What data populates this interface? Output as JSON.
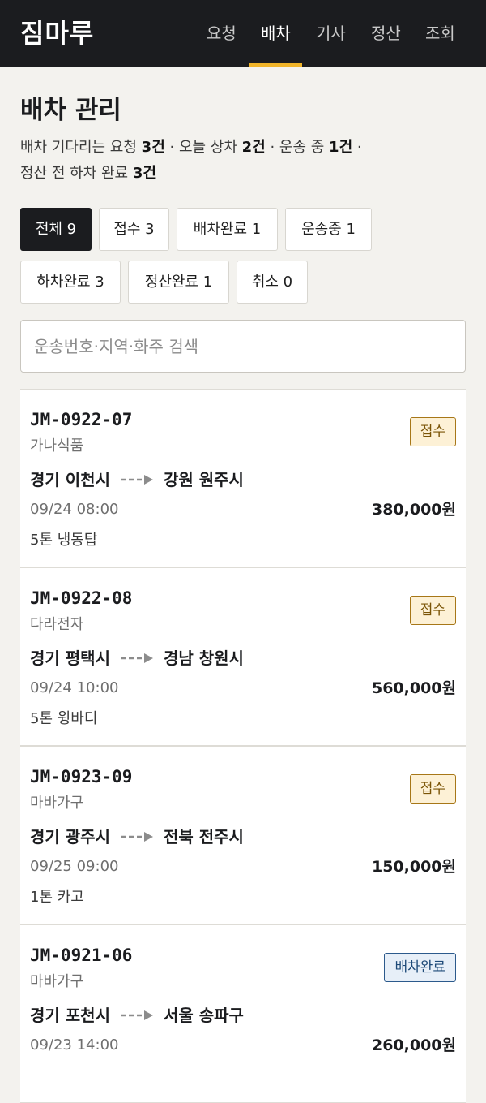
{
  "header": {
    "logo": "짐마루",
    "nav": [
      {
        "label": "요청",
        "active": false
      },
      {
        "label": "배차",
        "active": true
      },
      {
        "label": "기사",
        "active": false
      },
      {
        "label": "정산",
        "active": false
      },
      {
        "label": "조회",
        "active": false
      }
    ],
    "accent_color": "#f0b429"
  },
  "page": {
    "title": "배차 관리",
    "summary": {
      "waiting_label": "배차 기다리는 요청",
      "waiting_count": "3건",
      "loading_today_label": "오늘 상차",
      "loading_today_count": "2건",
      "in_transit_label": "운송 중",
      "in_transit_count": "1건",
      "unloaded_label": "정산 전 하차 완료",
      "unloaded_count": "3건"
    }
  },
  "filters": [
    {
      "label": "전체 9",
      "active": true
    },
    {
      "label": "접수 3",
      "active": false
    },
    {
      "label": "배차완료 1",
      "active": false
    },
    {
      "label": "운송중 1",
      "active": false
    },
    {
      "label": "하차완료 3",
      "active": false
    },
    {
      "label": "정산완료 1",
      "active": false
    },
    {
      "label": "취소 0",
      "active": false
    }
  ],
  "search": {
    "placeholder": "운송번호·지역·화주 검색",
    "value": ""
  },
  "shipments": [
    {
      "code": "JM-0922-07",
      "shipper": "가나식품",
      "from": "경기 이천시",
      "to": "강원 원주시",
      "datetime": "09/24 08:00",
      "price": "380,000원",
      "vehicle": "5톤 냉동탑",
      "status": "접수",
      "status_type": "received"
    },
    {
      "code": "JM-0922-08",
      "shipper": "다라전자",
      "from": "경기 평택시",
      "to": "경남 창원시",
      "datetime": "09/24 10:00",
      "price": "560,000원",
      "vehicle": "5톤 윙바디",
      "status": "접수",
      "status_type": "received"
    },
    {
      "code": "JM-0923-09",
      "shipper": "마바가구",
      "from": "경기 광주시",
      "to": "전북 전주시",
      "datetime": "09/25 09:00",
      "price": "150,000원",
      "vehicle": "1톤 카고",
      "status": "접수",
      "status_type": "received"
    },
    {
      "code": "JM-0921-06",
      "shipper": "마바가구",
      "from": "경기 포천시",
      "to": "서울 송파구",
      "datetime": "09/23 14:00",
      "price": "260,000원",
      "vehicle": "",
      "status": "배차완료",
      "status_type": "assigned"
    }
  ],
  "colors": {
    "header_bg": "#1b1c1f",
    "page_bg": "#f3f2ee",
    "badge_received": "#fdf1d6",
    "badge_assigned": "#e7eff8"
  }
}
